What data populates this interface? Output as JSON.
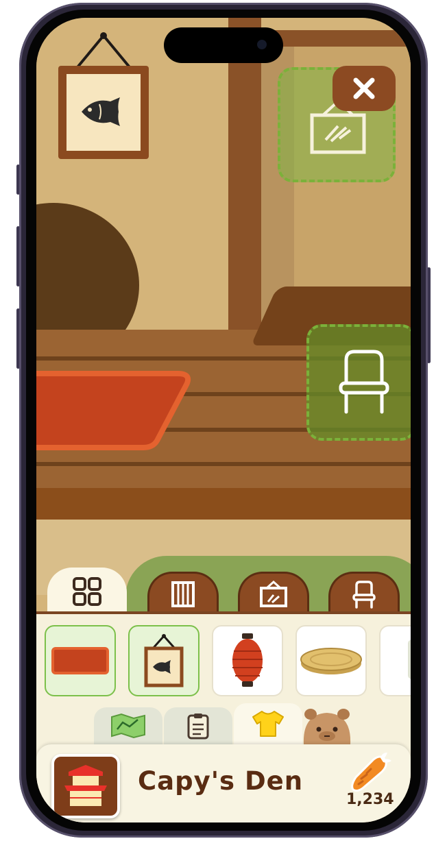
{
  "room": {
    "title": "Capy's Den"
  },
  "currency": {
    "icon": "carrot-icon",
    "value": "1,234"
  },
  "furniture_tabs": [
    {
      "name": "all",
      "icon": "grid-icon",
      "active": true
    },
    {
      "name": "storage",
      "icon": "shelf-icon",
      "active": false
    },
    {
      "name": "wall-decor",
      "icon": "picture-frame-icon",
      "active": false
    },
    {
      "name": "seating",
      "icon": "chair-icon",
      "active": false
    }
  ],
  "items": [
    {
      "icon": "red-rug-icon",
      "selected": true
    },
    {
      "icon": "fish-picture-icon",
      "selected": true
    },
    {
      "icon": "paper-lantern-icon",
      "selected": false
    },
    {
      "icon": "round-cushion-icon",
      "selected": false
    },
    {
      "icon": "item-partial-icon",
      "selected": false
    }
  ],
  "category_tabs": [
    {
      "icon": "map-icon",
      "active": false
    },
    {
      "icon": "clipboard-icon",
      "active": false
    },
    {
      "icon": "shirt-icon",
      "active": true
    },
    {
      "icon": "capybara-icon",
      "active": false
    }
  ],
  "colors": {
    "accent_green": "#7bb13a",
    "brown": "#8b4a22",
    "shirt_yellow": "#ffd21a",
    "carrot_orange": "#f28a23"
  }
}
